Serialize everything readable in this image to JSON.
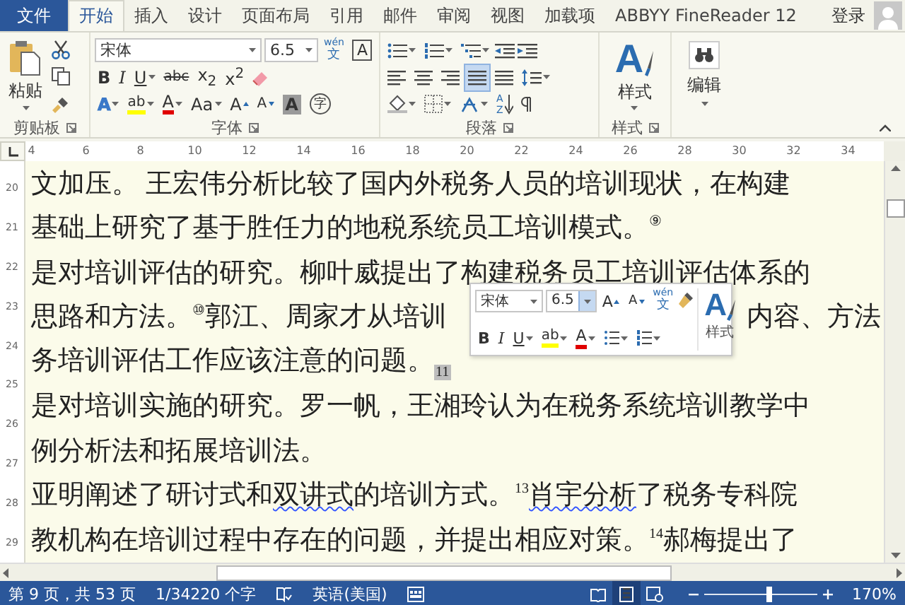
{
  "tabs": [
    {
      "label": "文件",
      "kind": "file",
      "selected": false
    },
    {
      "label": "开始",
      "kind": "tab",
      "selected": true
    },
    {
      "label": "插入",
      "kind": "tab",
      "selected": false
    },
    {
      "label": "设计",
      "kind": "tab",
      "selected": false
    },
    {
      "label": "页面布局",
      "kind": "tab",
      "selected": false
    },
    {
      "label": "引用",
      "kind": "tab",
      "selected": false
    },
    {
      "label": "邮件",
      "kind": "tab",
      "selected": false
    },
    {
      "label": "审阅",
      "kind": "tab",
      "selected": false
    },
    {
      "label": "视图",
      "kind": "tab",
      "selected": false
    },
    {
      "label": "加载项",
      "kind": "tab",
      "selected": false
    },
    {
      "label": "ABBYY FineReader 12",
      "kind": "tab",
      "selected": false
    }
  ],
  "account": {
    "label": "登录"
  },
  "ribbon": {
    "clipboard": {
      "paste_label": "粘贴",
      "group_label": "剪贴板"
    },
    "font": {
      "font_name": "宋体",
      "font_size": "6.5",
      "phonetic": {
        "top": "wén",
        "bottom": "文"
      },
      "boxed": "A",
      "group_label": "字体",
      "format_buttons": [
        {
          "text": "B",
          "kind": "bold"
        },
        {
          "text": "I",
          "kind": "italic"
        },
        {
          "text": "U",
          "kind": "underline"
        },
        {
          "text": "abc",
          "kind": "strike"
        },
        {
          "text": "x$_{2}$",
          "kind": "subscript"
        },
        {
          "text": "x$^{2}$",
          "kind": "superscript"
        }
      ],
      "effect_buttons": [
        {
          "text": "A",
          "kind": "effect"
        },
        {
          "text": "ab",
          "kind": "highlight"
        },
        {
          "text": "A",
          "kind": "color"
        },
        {
          "text": "Aa",
          "kind": "case"
        },
        {
          "text": "A",
          "kind": "grow"
        },
        {
          "text": "A",
          "kind": "shrink"
        },
        {
          "text": "A",
          "kind": "shade"
        },
        {
          "text": "字",
          "kind": "circle"
        }
      ]
    },
    "paragraph": {
      "group_label": "段落",
      "sort_letters": [
        "A",
        "Z"
      ],
      "alignments": [
        {
          "kind": "left",
          "selected": false
        },
        {
          "kind": "center",
          "selected": false
        },
        {
          "kind": "right",
          "selected": false
        },
        {
          "kind": "justify",
          "selected": true
        },
        {
          "kind": "distribute",
          "selected": false
        }
      ]
    },
    "styles": {
      "icon_letter": "A",
      "button_label": "样式",
      "group_label": "样式"
    },
    "editing": {
      "button_label": "编辑"
    }
  },
  "ruler": {
    "marks": [
      "4",
      "6",
      "8",
      "10",
      "12",
      "14",
      "16",
      "18",
      "20",
      "22",
      "24",
      "26",
      "28",
      "30",
      "32",
      "34"
    ]
  },
  "vertical_ruler": {
    "marks": [
      "20",
      "21",
      "22",
      "23",
      "24",
      "25",
      "26",
      "27",
      "28",
      "29"
    ]
  },
  "document": {
    "lines": [
      {
        "segments": [
          {
            "kind": "plain",
            "text": "文加压。 王宏伟分析比较了国内外税务人员的培训现状，在构建"
          }
        ]
      },
      {
        "segments": [
          {
            "kind": "plain",
            "text": "基础上研究了基于胜任力的地税系统员工培训模式。"
          },
          {
            "kind": "sup",
            "text": "⑨"
          }
        ]
      },
      {
        "segments": [
          {
            "kind": "plain",
            "text": "是对培训评估的研究。柳叶威提出了构建税务员工培训评估体系的"
          }
        ]
      },
      {
        "segments": [
          {
            "kind": "plain",
            "text": "思路和方法。"
          },
          {
            "kind": "sup",
            "text": "⑩"
          },
          {
            "kind": "plain",
            "text": "郭江、周家才从培训"
          },
          {
            "kind": "after-toolbar",
            "text": "内容、方法"
          }
        ]
      },
      {
        "segments": [
          {
            "kind": "plain",
            "text": "务培训评估工作应该注意的问题。"
          },
          {
            "kind": "highlight",
            "text": "11"
          }
        ]
      },
      {
        "segments": [
          {
            "kind": "plain",
            "text": "是对培训实施的研究。罗一帆，王湘玲认为在税务系统培训教学中"
          }
        ]
      },
      {
        "segments": [
          {
            "kind": "plain",
            "text": "例分析法和拓展培训法。"
          }
        ]
      },
      {
        "segments": [
          {
            "kind": "plain",
            "text": "亚明阐述了研讨式和"
          },
          {
            "kind": "wavy",
            "text": "双讲式"
          },
          {
            "kind": "plain",
            "text": "的培训方式。"
          },
          {
            "kind": "sup",
            "text": "13"
          },
          {
            "kind": "wavy",
            "text": "肖宇分析"
          },
          {
            "kind": "plain",
            "text": "了税务专科院"
          }
        ]
      },
      {
        "segments": [
          {
            "kind": "plain",
            "text": "教机构在培训过程中存在的问题，并提出相应对策。"
          },
          {
            "kind": "sup",
            "text": "14"
          },
          {
            "kind": "plain",
            "text": "郝梅提出了"
          }
        ]
      }
    ]
  },
  "mini_toolbar": {
    "font_name": "宋体",
    "font_size": "6.5",
    "grow": "A",
    "shrink": "A",
    "phonetic": {
      "top": "wén",
      "bottom": "文"
    },
    "style_letter": "A",
    "style_label": "样式",
    "buttons": [
      {
        "text": "B",
        "kind": "bold"
      },
      {
        "text": "I",
        "kind": "italic"
      },
      {
        "text": "U",
        "kind": "underline"
      },
      {
        "text": "ab",
        "kind": "highlight"
      },
      {
        "text": "A",
        "kind": "color"
      }
    ]
  },
  "status_bar": {
    "page": "第 9 页，共 53 页",
    "words": "1/34220 个字",
    "language": "英语(美国)",
    "zoom": "170%",
    "zoom_slider": {
      "level": 0.58
    },
    "views": [
      {
        "kind": "read",
        "selected": false
      },
      {
        "kind": "print",
        "selected": true
      },
      {
        "kind": "web",
        "selected": false
      }
    ]
  }
}
